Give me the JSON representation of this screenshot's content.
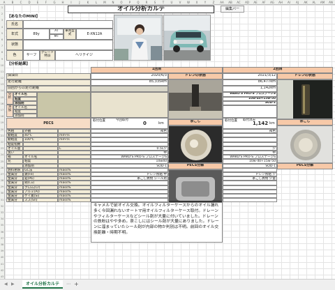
{
  "sheet": {
    "title": "オイル分析カルテ",
    "edit_bar": "編集バー",
    "tab": "オイル分析カルテ",
    "add_sheet": "+",
    "columns": [
      "A",
      "B",
      "C",
      "D",
      "E",
      "F",
      "G",
      "H",
      "I",
      "J",
      "K",
      "L",
      "M",
      "N",
      "O",
      "P",
      "Q",
      "R",
      "S",
      "T",
      "U",
      "V",
      "W",
      "X",
      "Y",
      "Z",
      "AA",
      "AB",
      "AC",
      "AD",
      "AE",
      "AF",
      "AG",
      "AH",
      "AI",
      "AJ",
      "AK",
      "AL",
      "AM",
      "AN"
    ]
  },
  "owner": {
    "section": "【あなたのMINI】",
    "name_label": "氏名",
    "name_value": "",
    "year_label": "年式",
    "year_value": "89y",
    "at_value": "AT",
    "mt_value": "MT",
    "model_label": "車両型式",
    "model_value": "E-XN12A",
    "status_label": "状態",
    "color_label": "色",
    "color_value": "サーフ",
    "grade_label": "グレード特派",
    "grade_value": "ヘリテイジ"
  },
  "analysis": {
    "section": "【分析結果】",
    "round1": "1回目",
    "round2": "2回目",
    "date_label": "採油日",
    "date1": "2020/6/3",
    "date2": "2021/3/12",
    "mileage_label": "走行距離",
    "mileage1": "85,335km",
    "mileage2": "86,477km",
    "prev_label": "前回からの走行距離",
    "prev2": "1,142km",
    "drain_title": "ドレンの状態",
    "cat1": "分析",
    "cat2": "添加",
    "oilname_label": "オイル名",
    "viscosity_label": "粘度",
    "additive_label": "添加剤",
    "oil1": "",
    "oil2": "WAKO'S PRO-S プロステージS",
    "visc2": "10w-40+15w-50",
    "add2": "SOD-1",
    "pecs_label": "PECS",
    "prev_count_label": "今回取付",
    "attach_label": "取付位置",
    "attach_value": "0",
    "dist_label": "取付済み",
    "dist_value": "1,142",
    "unit_km": "km",
    "strainer_title": "茶こし",
    "pecs_decomp_title": "PECS分解"
  },
  "props": [
    {
      "label": "色相",
      "sub": "外観",
      "v1": "褐色",
      "v2": "褐色"
    },
    {
      "label": "動粘度",
      "sub": "40℃",
      "unit": "mm²/s",
      "v1": "",
      "v2": ""
    },
    {
      "label": "動粘度",
      "sub": "100℃",
      "unit": "mm²/s",
      "v1": "",
      "v2": ""
    },
    {
      "label": "粘度指数",
      "sub": "",
      "v1": "",
      "v2": ""
    },
    {
      "label": "オイル量",
      "sub": "",
      "unit": "L",
      "v1": "0.5L少",
      "v2": "少"
    },
    {
      "label": "臭い",
      "sub": "",
      "v1": "中",
      "v2": "中"
    },
    {
      "label": "補",
      "sub": "オイル名",
      "v1": "WAKO'S PRO-S プロステージS",
      "v2": "WAKO'S PRO-S プロステージS"
    },
    {
      "label": "充",
      "sub": "粘度",
      "v1": "10w40",
      "v2": "10w-40+15w-50"
    },
    {
      "label": "",
      "sub": "添加剤",
      "v1": "SOD-1",
      "v2": "SOD-1"
    },
    {
      "label": "燃料希釈",
      "sub": "GC法",
      "unit": "mass%",
      "v1": "",
      "v2": ""
    },
    {
      "label": "金属分",
      "sub": "鉄(Fe)",
      "unit": "mass%",
      "v1": "ドレン残粘 中",
      "v2": "ドレン残粘 少"
    },
    {
      "label": "金属分",
      "sub": "鉛(Pb)",
      "unit": "mass%",
      "v1": "茶こし異物 シール剤",
      "v2": "茶こし異物 少量"
    },
    {
      "label": "金属分",
      "sub": "銅(Cu)",
      "unit": "mass%",
      "v1": "",
      "v2": ""
    },
    {
      "label": "金属分",
      "sub": "クロム(Cr)",
      "unit": "mass%",
      "v1": "",
      "v2": ""
    },
    {
      "label": "金属分",
      "sub": "アルミ(Al)",
      "unit": "mass%",
      "v1": "",
      "v2": ""
    },
    {
      "label": "金属分",
      "sub": "ケイ素(Si)",
      "unit": "mass%",
      "v1": "",
      "v2": ""
    },
    {
      "label": "金属分",
      "sub": "スズ(Sn)",
      "unit": "mass%",
      "v1": "",
      "v2": ""
    }
  ],
  "comment": "キャメルで前オイル交換。オイルフィルターケースからのオイル漏れ多く今回漏れないオートマ用オイルフィルターケース取付。ドレーンやフィルターケースなどシール剤が大量に付いていました。ドレーンの鉄粉はやや多め。茶こしにはシール剤が大量にありました。ドレーンに溜まっていたシール剤が内部の物か判別は不明。前回のオイル交換距離・時期不明。",
  "colors": {
    "header": "#f7c9a8",
    "label": "#f3ecd8",
    "accent": "#1e7145"
  }
}
